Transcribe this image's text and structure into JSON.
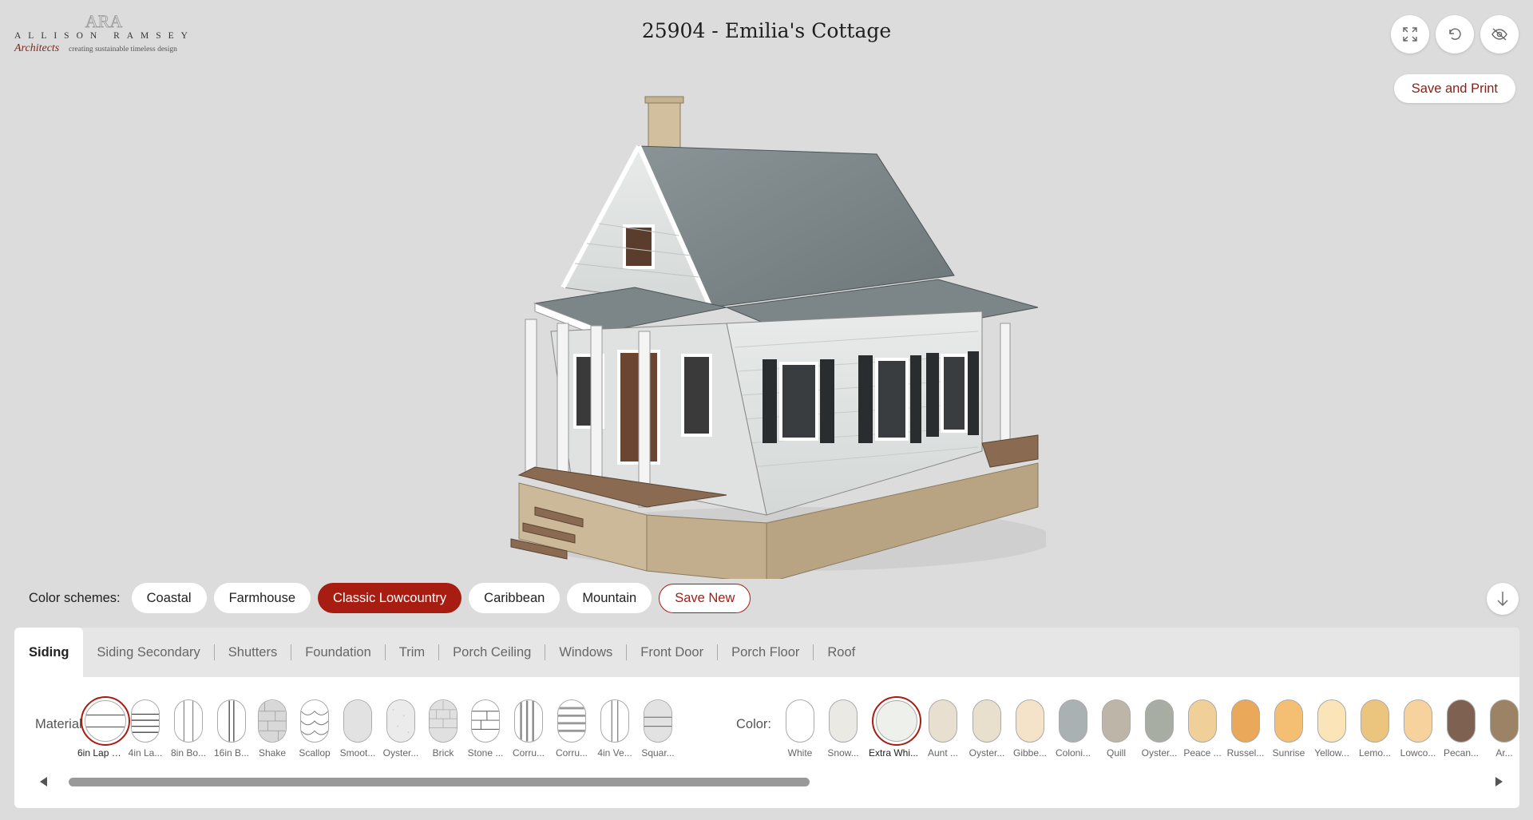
{
  "logo": {
    "name": "ALLISON RAMSEY",
    "sub_script": "Architects",
    "sub_tagline": "creating sustainable timeless design",
    "monogram": "ARA"
  },
  "title": "25904 - Emilia's Cottage",
  "toolbar": {
    "fullscreen_icon": "expand-icon",
    "reset_icon": "rotate-ccw-icon",
    "hide_icon": "eye-off-icon",
    "save_print_label": "Save and Print"
  },
  "schemes": {
    "label": "Color schemes:",
    "items": [
      {
        "label": "Coastal",
        "active": false
      },
      {
        "label": "Farmhouse",
        "active": false
      },
      {
        "label": "Classic Lowcountry",
        "active": true
      },
      {
        "label": "Caribbean",
        "active": false
      },
      {
        "label": "Mountain",
        "active": false
      }
    ],
    "save_new_label": "Save New",
    "collapse_icon": "arrow-down-icon"
  },
  "tabs": [
    {
      "label": "Siding",
      "active": true
    },
    {
      "label": "Siding Secondary",
      "active": false
    },
    {
      "label": "Shutters",
      "active": false
    },
    {
      "label": "Foundation",
      "active": false
    },
    {
      "label": "Trim",
      "active": false
    },
    {
      "label": "Porch Ceiling",
      "active": false
    },
    {
      "label": "Windows",
      "active": false
    },
    {
      "label": "Front Door",
      "active": false
    },
    {
      "label": "Porch Floor",
      "active": false
    },
    {
      "label": "Roof",
      "active": false
    }
  ],
  "materials": {
    "label": "Material:",
    "items": [
      {
        "label": "6in Lap Si...",
        "pattern": "lap-wide",
        "selected": true
      },
      {
        "label": "4in La...",
        "pattern": "lap-narrow",
        "selected": false
      },
      {
        "label": "8in Bo...",
        "pattern": "board-batten",
        "selected": false
      },
      {
        "label": "16in B...",
        "pattern": "board-batten-wide",
        "selected": false
      },
      {
        "label": "Shake",
        "pattern": "shake",
        "selected": false
      },
      {
        "label": "Scallop",
        "pattern": "scallop",
        "selected": false
      },
      {
        "label": "Smoot...",
        "pattern": "smooth",
        "selected": false
      },
      {
        "label": "Oyster...",
        "pattern": "oyster",
        "selected": false
      },
      {
        "label": "Brick",
        "pattern": "brick",
        "selected": false
      },
      {
        "label": "Stone ...",
        "pattern": "stone",
        "selected": false
      },
      {
        "label": "Corru...",
        "pattern": "corrugated-v",
        "selected": false
      },
      {
        "label": "Corru...",
        "pattern": "corrugated-h",
        "selected": false
      },
      {
        "label": "4in Ve...",
        "pattern": "vertical",
        "selected": false
      },
      {
        "label": "Squar...",
        "pattern": "square",
        "selected": false
      }
    ]
  },
  "colors": {
    "label": "Color:",
    "items": [
      {
        "label": "White",
        "hex": "#ffffff",
        "selected": false
      },
      {
        "label": "Snow...",
        "hex": "#ebe9e4",
        "selected": false
      },
      {
        "label": "Extra Whi...",
        "hex": "#eef0ec",
        "selected": true
      },
      {
        "label": "Aunt ...",
        "hex": "#e8dfd0",
        "selected": false
      },
      {
        "label": "Oyster...",
        "hex": "#e9dfcd",
        "selected": false
      },
      {
        "label": "Gibbe...",
        "hex": "#f4e3c8",
        "selected": false
      },
      {
        "label": "Coloni...",
        "hex": "#a9b1b3",
        "selected": false
      },
      {
        "label": "Quill",
        "hex": "#bdb5a7",
        "selected": false
      },
      {
        "label": "Oyster...",
        "hex": "#a7ada3",
        "selected": false
      },
      {
        "label": "Peace ...",
        "hex": "#f0cf99",
        "selected": false
      },
      {
        "label": "Russel...",
        "hex": "#e9a85a",
        "selected": false
      },
      {
        "label": "Sunrise",
        "hex": "#f5bf73",
        "selected": false
      },
      {
        "label": "Yellow...",
        "hex": "#fae4b8",
        "selected": false
      },
      {
        "label": "Lemo...",
        "hex": "#ebc47e",
        "selected": false
      },
      {
        "label": "Lowco...",
        "hex": "#f7d29c",
        "selected": false
      },
      {
        "label": "Pecan...",
        "hex": "#7f6151",
        "selected": false
      },
      {
        "label": "Ar...",
        "hex": "#9c8365",
        "selected": false
      }
    ]
  },
  "accent": "#a71d12"
}
